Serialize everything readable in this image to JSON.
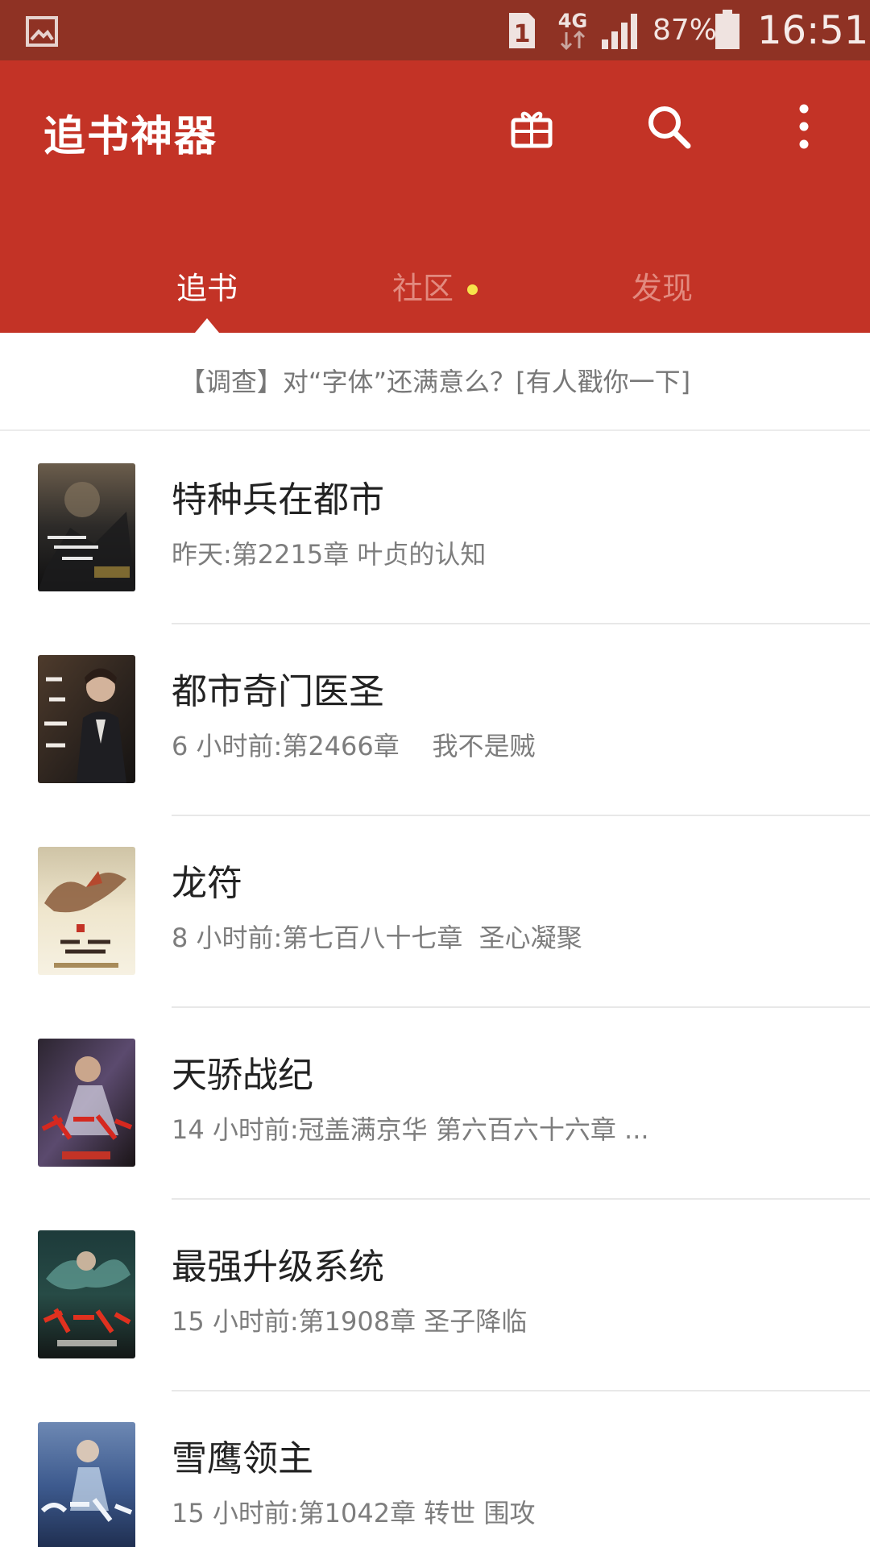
{
  "status_bar": {
    "network": "4G",
    "battery": "87%",
    "time": "16:51",
    "icons": [
      "gallery-icon",
      "sim-1-icon",
      "network-4g-icon",
      "signal-icon",
      "battery-icon"
    ]
  },
  "app_bar": {
    "title": "追书神器",
    "actions": [
      "gift-icon",
      "search-icon",
      "more-vert-icon"
    ],
    "accent_color": "#c33326",
    "status_color": "#8f3224"
  },
  "tabs": [
    {
      "label": "追书",
      "active": true
    },
    {
      "label": "社区",
      "active": false,
      "badge": "dot"
    },
    {
      "label": "发现",
      "active": false
    }
  ],
  "survey": {
    "text": "【调查】对“字体”还满意么？[有人戳你一下]"
  },
  "books": [
    {
      "title": "特种兵在都市",
      "update": "昨天:第2215章 叶贞的认知"
    },
    {
      "title": "都市奇门医圣",
      "update": "6 小时前:第2466章    我不是贼"
    },
    {
      "title": "龙符",
      "update": "8 小时前:第七百八十七章  圣心凝聚"
    },
    {
      "title": "天骄战纪",
      "update": "14 小时前:冠盖满京华 第六百六十六章 ..."
    },
    {
      "title": "最强升级系统",
      "update": "15 小时前:第1908章 圣子降临"
    },
    {
      "title": "雪鹰领主",
      "update": "15 小时前:第1042章 转世 围攻"
    }
  ]
}
